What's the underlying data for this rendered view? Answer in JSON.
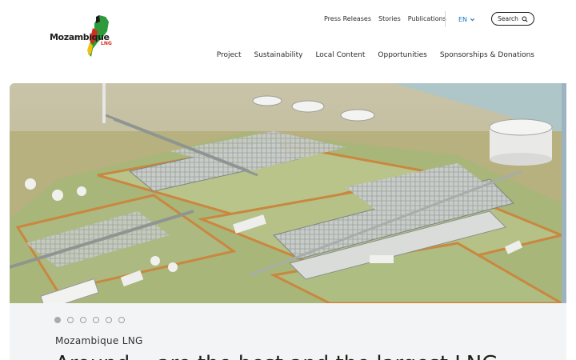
{
  "brand": {
    "name": "Mozambique",
    "sub": "LNG",
    "colors": {
      "red": "#d62b1e",
      "green": "#2e9a3a",
      "yellow": "#f2c20f",
      "black": "#1d1d1b"
    }
  },
  "utility_nav": [
    "Press Releases",
    "Stories",
    "Publications"
  ],
  "language": {
    "label": "EN",
    "icon": "chevron-down-icon",
    "color": "#1976bd"
  },
  "search": {
    "label": "Search",
    "icon": "search-icon"
  },
  "main_nav": [
    "Project",
    "Sustainability",
    "Local Content",
    "Opportunities",
    "Sponsorships & Donations"
  ],
  "carousel": {
    "slide_count": 6,
    "active_index": 0,
    "kicker": "Mozambique LNG",
    "headline": "Around… are the best and the largest LNG"
  }
}
